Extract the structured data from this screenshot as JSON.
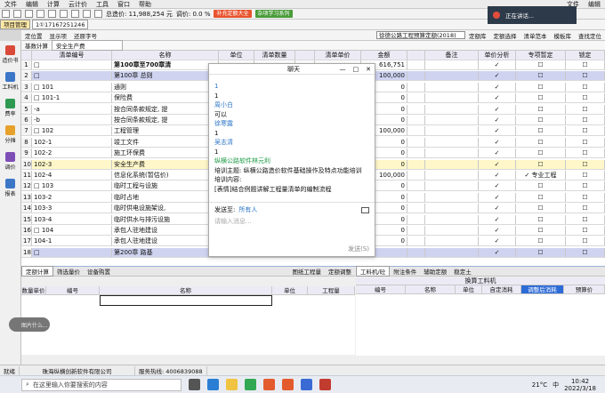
{
  "menubar": {
    "items": [
      "项目管理",
      "编辑",
      "计算",
      "云计价",
      "工具",
      "窗口",
      "帮助"
    ],
    "file_label": "文件",
    "edit_label": "编辑"
  },
  "toolbar1": {
    "total_label": "总造价: 11,988,254 元",
    "unit_label": "调价: 0.0 %",
    "badge1": "补充定额大全",
    "badge2": "杂项学习系列"
  },
  "toolbar2": {
    "tabs": [
      "项目管理",
      "1①17167251246"
    ],
    "filter_btn": "完工",
    "dropdown_label": "徐德公路工程预算定额(2018)",
    "items": [
      "定额库",
      "定额选择",
      "清单范本",
      "模板库",
      "查找定位"
    ]
  },
  "toolbar3": {
    "items": [
      "定位置",
      "显示项",
      "还原字号"
    ]
  },
  "toolbar4": {
    "items": [
      "基数计算",
      "安全生产费"
    ]
  },
  "sidebar": {
    "items": [
      "造价书",
      "工料机",
      "费率",
      "分摊",
      "调价",
      "报表"
    ]
  },
  "grid": {
    "headers": [
      "",
      "清单编号",
      "名称",
      "单位",
      "清单数量",
      "",
      "清单单价",
      "金额",
      "",
      "备注",
      "单价分析",
      "专项暂定",
      "锁定"
    ],
    "rows": [
      {
        "num": "1",
        "code": "□",
        "name": "第100章至700章清",
        "unit": "",
        "qty": "",
        "price": "",
        "amount": "616,751",
        "note": "",
        "a": "✓",
        "b": "☐",
        "c": "☐"
      },
      {
        "num": "2",
        "code": "  □",
        "name": "第100章  总则",
        "unit": "",
        "qty": "",
        "price": "",
        "amount": "100,000",
        "note": "",
        "a": "✓",
        "b": "☐",
        "c": "☐"
      },
      {
        "num": "3",
        "code": "  □ 101",
        "name": "通则",
        "unit": "",
        "qty": "",
        "price": "",
        "amount": "0",
        "note": "",
        "a": "✓",
        "b": "☐",
        "c": "☐"
      },
      {
        "num": "4",
        "code": "    □ 101-1",
        "name": "保险费",
        "unit": "",
        "qty": "",
        "price": "",
        "amount": "0",
        "note": "",
        "a": "✓",
        "b": "☐",
        "c": "☐"
      },
      {
        "num": "5",
        "code": "       -a",
        "name": "按合同条款规定, 提",
        "unit": "",
        "qty": "",
        "price": "",
        "amount": "0",
        "note": "",
        "a": "✓",
        "b": "☐",
        "c": "☐"
      },
      {
        "num": "6",
        "code": "       -b",
        "name": "按合同条款规定, 提",
        "unit": "",
        "qty": "",
        "price": "",
        "amount": "0",
        "note": "",
        "a": "✓",
        "b": "☐",
        "c": "☐"
      },
      {
        "num": "7",
        "code": "  □ 102",
        "name": "工程管理",
        "unit": "",
        "qty": "",
        "price": "",
        "amount": "100,000",
        "note": "",
        "a": "✓",
        "b": "☐",
        "c": "☐"
      },
      {
        "num": "8",
        "code": "       102-1",
        "name": "竣工文件",
        "unit": "",
        "qty": "",
        "price": "",
        "amount": "0",
        "note": "",
        "a": "✓",
        "b": "☐",
        "c": "☐"
      },
      {
        "num": "9",
        "code": "       102-2",
        "name": "施工环保费",
        "unit": "",
        "qty": "",
        "price": "",
        "amount": "0",
        "note": "",
        "a": "✓",
        "b": "☐",
        "c": "☐"
      },
      {
        "num": "10",
        "code": "       102-3",
        "name": "安全生产费",
        "unit": "",
        "qty": "",
        "price": "",
        "amount": "0",
        "note": "",
        "a": "✓",
        "b": "☐",
        "c": "☐"
      },
      {
        "num": "11",
        "code": "       102-4",
        "name": "信息化系统(暂估价)",
        "unit": "",
        "qty": "",
        "price": "",
        "amount": "100,000",
        "note": "",
        "a": "✓",
        "b": "✓",
        "c": "☐",
        "special": "专业工程"
      },
      {
        "num": "12",
        "code": "  □ 103",
        "name": "临时工程与设施",
        "unit": "",
        "qty": "",
        "price": "",
        "amount": "0",
        "note": "",
        "a": "✓",
        "b": "☐",
        "c": "☐"
      },
      {
        "num": "13",
        "code": "       103-2",
        "name": "临时占地",
        "unit": "",
        "qty": "",
        "price": "",
        "amount": "0",
        "note": "",
        "a": "✓",
        "b": "☐",
        "c": "☐"
      },
      {
        "num": "14",
        "code": "       103-3",
        "name": "临时供电设施架设,",
        "unit": "",
        "qty": "",
        "price": "",
        "amount": "0",
        "note": "",
        "a": "✓",
        "b": "☐",
        "c": "☐"
      },
      {
        "num": "15",
        "code": "       103-4",
        "name": "临时供水与排污设施",
        "unit": "",
        "qty": "",
        "price": "",
        "amount": "0",
        "note": "",
        "a": "✓",
        "b": "☐",
        "c": "☐"
      },
      {
        "num": "16",
        "code": "  □ 104",
        "name": "承包人驻地建设",
        "unit": "",
        "qty": "",
        "price": "",
        "amount": "0",
        "note": "",
        "a": "✓",
        "b": "☐",
        "c": "☐"
      },
      {
        "num": "17",
        "code": "       104-1",
        "name": "承包人驻地建设",
        "unit": "",
        "qty": "",
        "price": "",
        "amount": "0",
        "note": "",
        "a": "✓",
        "b": "☐",
        "c": "☐"
      },
      {
        "num": "18",
        "code": "  □",
        "name": "第200章  路基",
        "unit": "",
        "qty": "",
        "price": "",
        "amount": "",
        "note": "",
        "a": "✓",
        "b": "☐",
        "c": "☐"
      }
    ]
  },
  "bottom": {
    "left_tabs": [
      "定额计算",
      "筛选量价",
      "设备购置"
    ],
    "left_tools": [
      "图纸工程量",
      "定额调整"
    ],
    "left_headers": [
      "数量单价",
      "编号",
      "名称",
      "单位",
      "工程量"
    ],
    "right_tabs": [
      "工料机/砼",
      "附注条件",
      "辅助定额",
      "稳定土"
    ],
    "right_title": "换算工料机",
    "right_headers": [
      "编号",
      "名称",
      "单位",
      "自定消耗",
      "调整后消耗",
      "预算价"
    ]
  },
  "chat": {
    "title": "聊天",
    "messages": [
      {
        "text": "1",
        "cls": "blue"
      },
      {
        "text": "1",
        "cls": ""
      },
      {
        "text": "周小白",
        "cls": "blue"
      },
      {
        "text": "可以",
        "cls": ""
      },
      {
        "text": "徐寒露",
        "cls": "blue"
      },
      {
        "text": "1",
        "cls": ""
      },
      {
        "text": "吴志清",
        "cls": "blue"
      },
      {
        "text": "1",
        "cls": ""
      },
      {
        "text": "纵横公路软件林元利",
        "cls": "green"
      },
      {
        "text": "培训主题: 纵横公路造价软件基础操作及特点功能培训",
        "cls": ""
      },
      {
        "text": "    培训内容:",
        "cls": ""
      },
      {
        "text": "    [表情]结合例题讲解工程量清单的编制流程",
        "cls": ""
      }
    ],
    "send_to_label": "发送至:",
    "send_to_value": "所有人",
    "input_placeholder": "请输入消息...",
    "send_button": "发送(S)"
  },
  "statusbar": {
    "items": [
      "就绪",
      "珠海纵横创新软件有限公司",
      "服务热线: 4006839088"
    ]
  },
  "taskbar": {
    "search_placeholder": "在这里输入你要搜索的内容",
    "weather": "21°C",
    "time": "10:42",
    "date": "2022/3/18",
    "lang": "中"
  },
  "notify": {
    "text": "正在讲话..."
  },
  "ime": {
    "label": "中"
  },
  "toast": {
    "text": "图片什么..."
  }
}
